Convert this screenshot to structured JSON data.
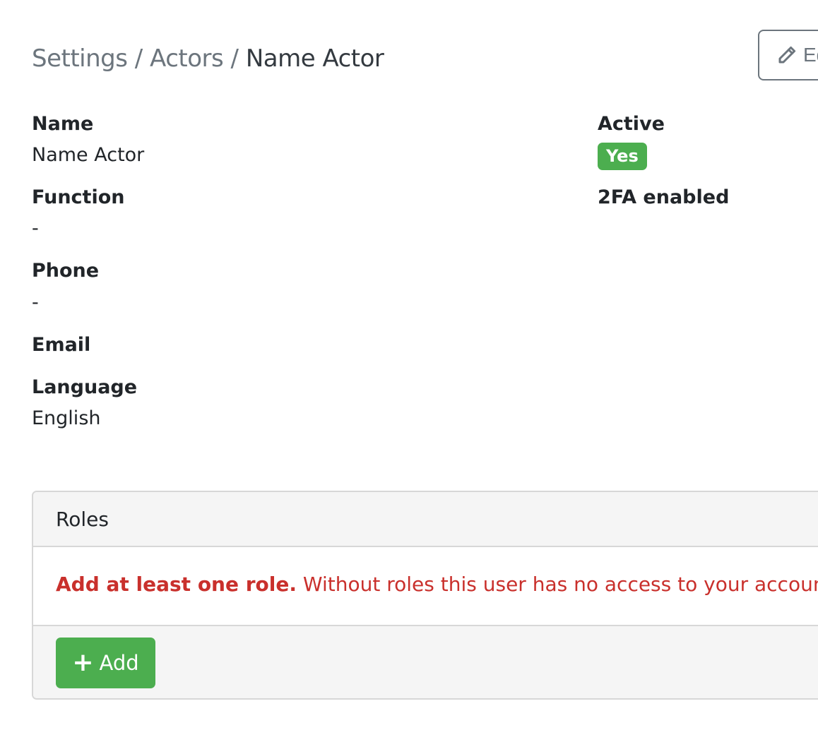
{
  "breadcrumb": {
    "settings": "Settings",
    "actors": "Actors",
    "separator": "/",
    "current": "Name Actor"
  },
  "toolbar": {
    "edit_label": "Edit",
    "edit_icon": "pencil-icon"
  },
  "fields": {
    "name": {
      "label": "Name",
      "value": "Name Actor"
    },
    "function": {
      "label": "Function",
      "value": "-"
    },
    "phone": {
      "label": "Phone",
      "value": "-"
    },
    "email": {
      "label": "Email",
      "value": ""
    },
    "language": {
      "label": "Language",
      "value": "English"
    },
    "active": {
      "label": "Active",
      "value": "Yes"
    },
    "twofa": {
      "label": "2FA enabled",
      "value": ""
    }
  },
  "roles": {
    "title": "Roles",
    "warning_bold": "Add at least one role.",
    "warning_text": " Without roles this user has no access to your account.",
    "add_label": "Add",
    "add_icon": "plus-icon"
  },
  "colors": {
    "success": "#4cae4f",
    "danger": "#c9302c",
    "muted": "#6c757d"
  }
}
